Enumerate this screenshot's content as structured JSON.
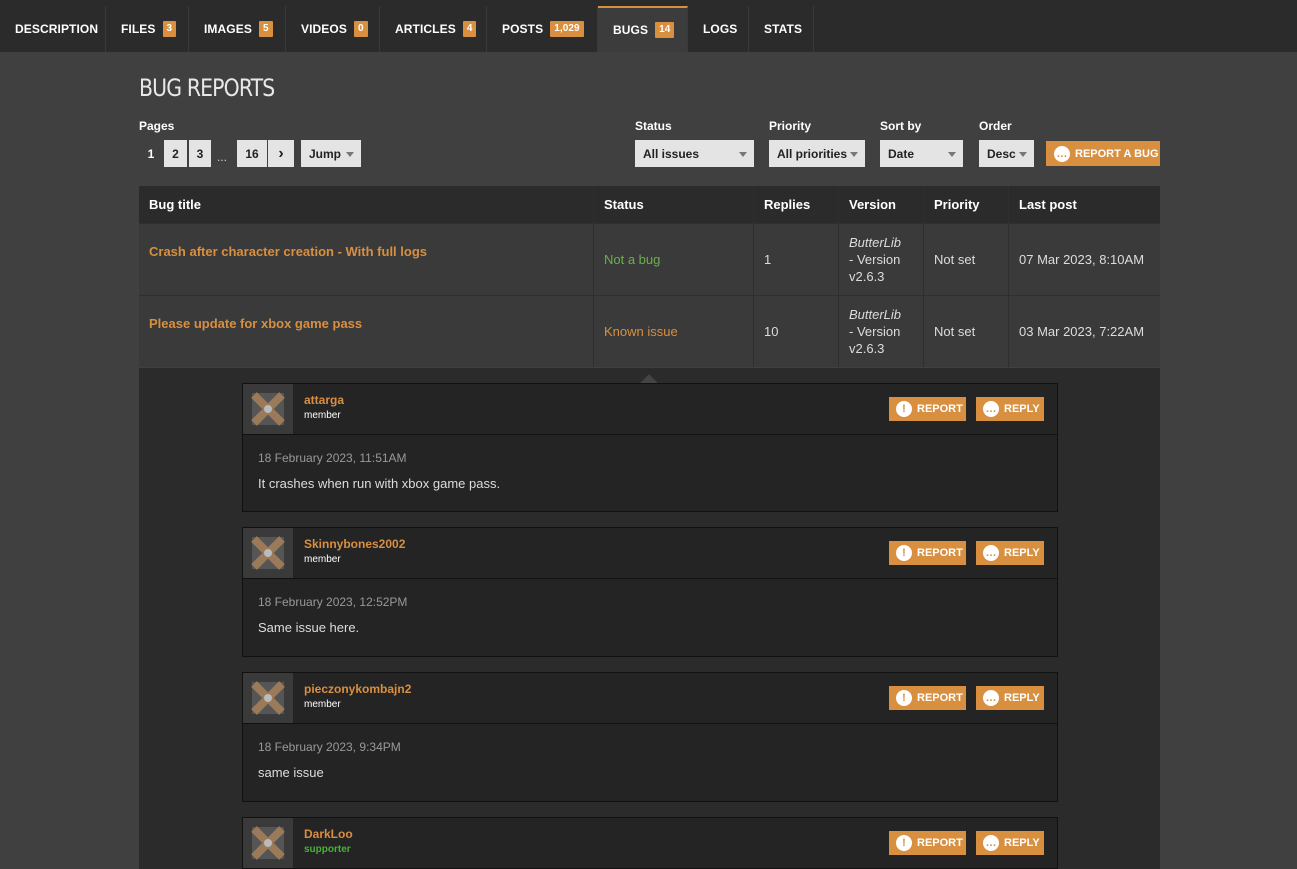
{
  "tabs": [
    {
      "label": "DESCRIPTION",
      "badge": ""
    },
    {
      "label": "FILES",
      "badge": "3"
    },
    {
      "label": "IMAGES",
      "badge": "5"
    },
    {
      "label": "VIDEOS",
      "badge": "0"
    },
    {
      "label": "ARTICLES",
      "badge": "4"
    },
    {
      "label": "POSTS",
      "badge": "1,029"
    },
    {
      "label": "BUGS",
      "badge": "14"
    },
    {
      "label": "LOGS",
      "badge": ""
    },
    {
      "label": "STATS",
      "badge": ""
    }
  ],
  "page_title": "BUG REPORTS",
  "filters": {
    "pages_label": "Pages",
    "pages": [
      "1",
      "2",
      "3"
    ],
    "ellipsis": "...",
    "last_page": "16",
    "next_glyph": "›",
    "jump": "Jump",
    "status_label": "Status",
    "status_value": "All issues",
    "priority_label": "Priority",
    "priority_value": "All priorities",
    "sort_label": "Sort by",
    "sort_value": "Date",
    "order_label": "Order",
    "order_value": "Desc",
    "report_bug": "REPORT A BUG"
  },
  "table": {
    "headers": [
      "Bug title",
      "Status",
      "Replies",
      "Version",
      "Priority",
      "Last post"
    ],
    "rows": [
      {
        "title": "Crash after character creation - With full logs",
        "status": "Not a bug",
        "replies": "1",
        "version_name": "ButterLib",
        "version_rest": "- Version v2.6.3",
        "priority": "Not set",
        "last_post": "07 Mar 2023, 8:10AM"
      },
      {
        "title": "Please update for xbox game pass",
        "status": "Known issue",
        "replies": "10",
        "version_name": "ButterLib",
        "version_rest": "- Version v2.6.3",
        "priority": "Not set",
        "last_post": "03 Mar 2023, 7:22AM"
      }
    ]
  },
  "comment_actions": {
    "report": "REPORT",
    "reply": "REPLY"
  },
  "comments": [
    {
      "user": "attarga",
      "role": "member",
      "time": "18 February 2023, 11:51AM",
      "text": "It crashes when run with xbox game pass."
    },
    {
      "user": "Skinnybones2002",
      "role": "member",
      "time": "18 February 2023, 12:52PM",
      "text": "Same issue here."
    },
    {
      "user": "pieczonykombajn2",
      "role": "member",
      "time": "18 February 2023, 9:34PM",
      "text": "same issue"
    },
    {
      "user": "DarkLoo",
      "role": "supporter",
      "time": "",
      "text": ""
    }
  ],
  "colors": {
    "accent": "#d98f40",
    "status_green": "#6ab04c",
    "supporter_green": "#4caf3a"
  }
}
